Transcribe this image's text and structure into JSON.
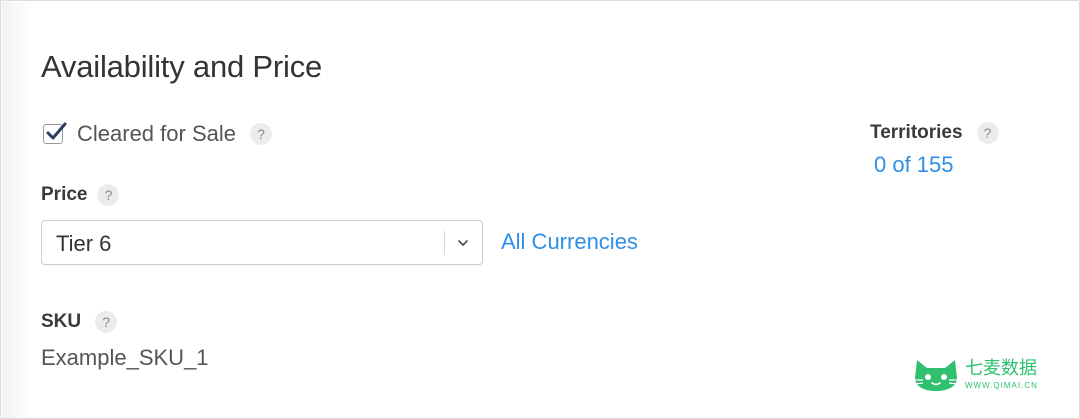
{
  "section": {
    "title": "Availability and Price"
  },
  "cleared_for_sale": {
    "label": "Cleared for Sale",
    "checked": true,
    "help": "?"
  },
  "price": {
    "label": "Price",
    "help": "?",
    "selected": "Tier 6",
    "currencies_link": "All Currencies"
  },
  "sku": {
    "label": "SKU",
    "help": "?",
    "value": "Example_SKU_1"
  },
  "territories": {
    "label": "Territories",
    "help": "?",
    "count_link": "0 of 155"
  },
  "watermark": {
    "name": "七麦数据",
    "url": "WWW.QIMAI.CN",
    "icon": "cat-logo-icon"
  },
  "colors": {
    "link": "#2f8fe6",
    "brand": "#2fbf6f"
  }
}
